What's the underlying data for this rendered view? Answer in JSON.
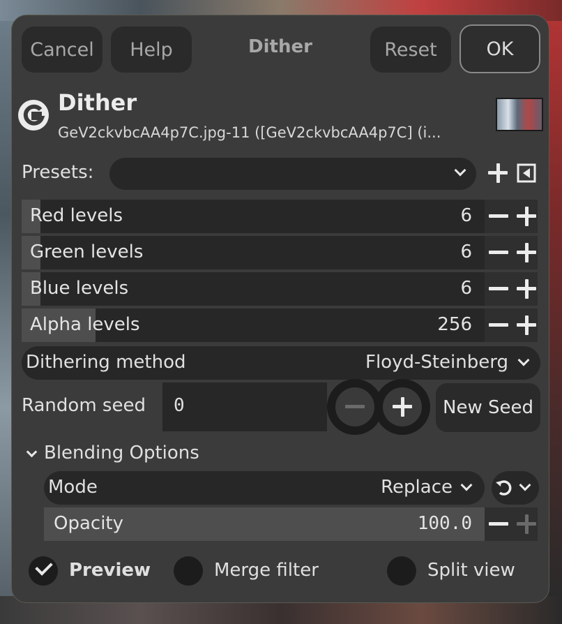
{
  "header": {
    "cancel_label": "Cancel",
    "help_label": "Help",
    "title": "Dither",
    "reset_label": "Reset",
    "ok_label": "OK"
  },
  "operation": {
    "logo_letter": "G",
    "title": "Dither",
    "subtitle": "GeV2ckvbcAA4p7C.jpg-11 ([GeV2ckvbcAA4p7C] (i..."
  },
  "presets": {
    "label": "Presets:",
    "value": ""
  },
  "sliders": [
    {
      "label": "Red levels",
      "value": "6",
      "fill": 0.04
    },
    {
      "label": "Green levels",
      "value": "6",
      "fill": 0.04
    },
    {
      "label": "Blue levels",
      "value": "6",
      "fill": 0.04
    },
    {
      "label": "Alpha levels",
      "value": "256",
      "fill": 0.16
    }
  ],
  "dithering": {
    "label": "Dithering method",
    "value": "Floyd-Steinberg"
  },
  "seed": {
    "label": "Random seed",
    "value": "0",
    "new_seed_label": "New Seed"
  },
  "blending": {
    "section_label": "Blending Options",
    "mode_label": "Mode",
    "mode_value": "Replace",
    "opacity_label": "Opacity",
    "opacity_value": "100.0",
    "opacity_fill": 1.0
  },
  "footer": {
    "preview_label": "Preview",
    "preview_checked": true,
    "merge_label": "Merge filter",
    "split_label": "Split view"
  }
}
